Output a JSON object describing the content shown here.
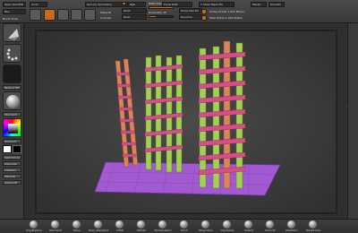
{
  "toolbar": {
    "fields": [
      "Open Def.ZPR",
      "Blur",
      "Undo",
      "Sym by Symmetry",
      "Sculpt",
      "Move",
      "Rgb",
      "Edit",
      "ZAdd",
      "Draw",
      "Smooth",
      "RGB Intensity 100",
      "ZIntensity 25",
      "Focal Shift",
      "Draw Size 64",
      "Dynamic",
      "Active Points 1.025 Million",
      "Total Points 1.025 Million",
      "Y  Show Mesh Fill"
    ],
    "labels": [
      "Brush Tools",
      "Material",
      "Colorize",
      "Morph",
      "Zadd",
      "Zsub"
    ]
  },
  "left": {
    "items": [
      "Lightbox",
      "Gradient",
      "SwitchColor",
      "Alternate",
      "Texture Off",
      "Material",
      "Standard",
      "Alpha Off"
    ]
  },
  "bottom": {
    "brushes": [
      "ClayBuildup",
      "Standard",
      "Move",
      "Dam_Standard",
      "Inflat",
      "hPolish",
      "TrimDynamic",
      "Pinch",
      "Move Topo",
      "ClayTubes",
      "Slash3",
      "Smooth",
      "MaskPen",
      "MaskCircle"
    ]
  },
  "colors": {
    "accent": "#d06a15",
    "ladder": "#d9845a",
    "pole": "#a3cf55",
    "rung": "#d44f8a",
    "floor": "#a25ad0"
  }
}
